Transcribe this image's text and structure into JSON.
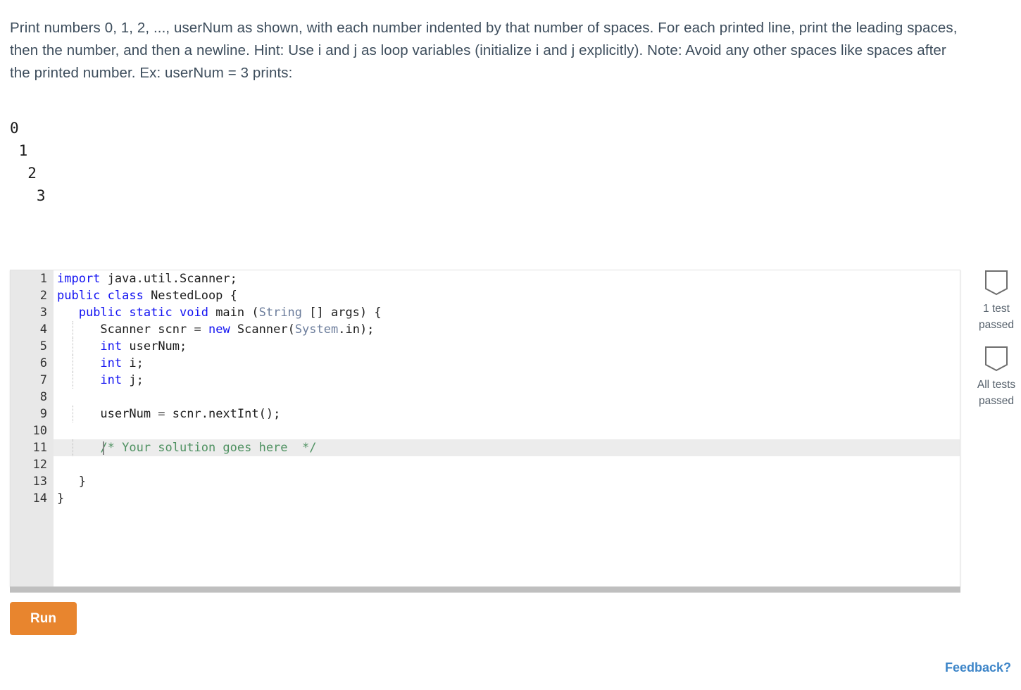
{
  "prompt": {
    "text": "Print numbers 0, 1, 2, ..., userNum as shown, with each number indented by that number of spaces. For each printed line, print the leading spaces, then the number, and then a newline. Hint: Use i and j as loop variables (initialize i and j explicitly). Note: Avoid any other spaces like spaces after the printed number. Ex: userNum = 3 prints:"
  },
  "sample_output": {
    "lines": [
      "0",
      " 1",
      "  2",
      "   3"
    ],
    "text": "0\n 1\n  2\n   3"
  },
  "editor": {
    "language": "java",
    "active_line": 11,
    "cursor_line": 11,
    "line_numbers": [
      1,
      2,
      3,
      4,
      5,
      6,
      7,
      8,
      9,
      10,
      11,
      12,
      13,
      14
    ],
    "lines": [
      {
        "n": 1,
        "plain": "import java.util.Scanner;"
      },
      {
        "n": 2,
        "plain": "public class NestedLoop {"
      },
      {
        "n": 3,
        "plain": "   public static void main (String [] args) {"
      },
      {
        "n": 4,
        "plain": "      Scanner scnr = new Scanner(System.in);"
      },
      {
        "n": 5,
        "plain": "      int userNum;"
      },
      {
        "n": 6,
        "plain": "      int i;"
      },
      {
        "n": 7,
        "plain": "      int j;"
      },
      {
        "n": 8,
        "plain": ""
      },
      {
        "n": 9,
        "plain": "      userNum = scnr.nextInt();"
      },
      {
        "n": 10,
        "plain": ""
      },
      {
        "n": 11,
        "plain": "      /* Your solution goes here  */"
      },
      {
        "n": 12,
        "plain": ""
      },
      {
        "n": 13,
        "plain": "   }"
      },
      {
        "n": 14,
        "plain": "}"
      }
    ],
    "colors": {
      "keyword": "#1212f2",
      "type": "#6b7c9b",
      "comment": "#4e9161",
      "gutter_bg": "#e8e8e8",
      "active_line_bg": "#ececec"
    }
  },
  "tests": {
    "badges": [
      {
        "icon": "shield-badge-icon",
        "label_line1": "1 test",
        "label_line2": "passed"
      },
      {
        "icon": "shield-badge-icon",
        "label_line1": "All tests",
        "label_line2": "passed"
      }
    ]
  },
  "actions": {
    "run_label": "Run",
    "run_color": "#e8852e",
    "feedback_label": "Feedback?",
    "feedback_color": "#3d85c8"
  }
}
